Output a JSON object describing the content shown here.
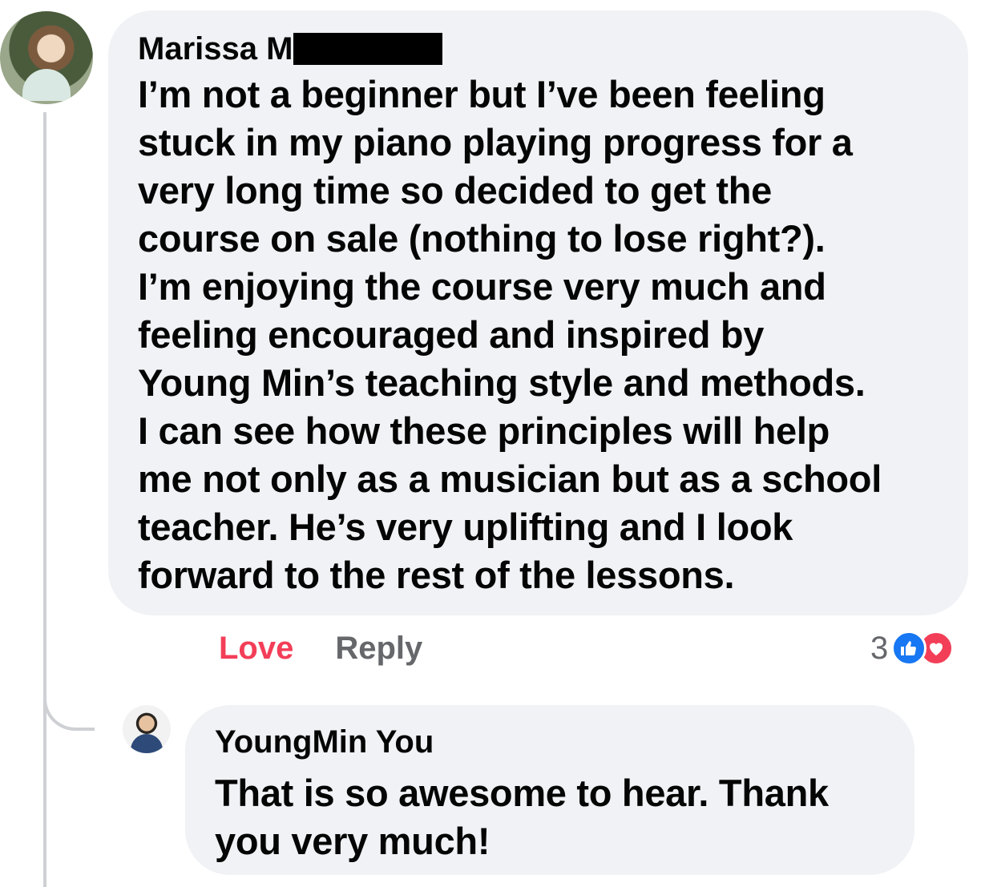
{
  "comment": {
    "author": "Marissa M",
    "author_redacted": true,
    "body_lines": [
      "I’m not a beginner but I’ve been feeling",
      "stuck in my piano playing progress for a",
      "very long time so decided to get the",
      "course on sale (nothing to lose right?).",
      "I’m enjoying the course very much and",
      "feeling encouraged and inspired by",
      "Young Min’s teaching style and methods.",
      "I can see how these principles will help",
      "me not only as a musician but as a school",
      "teacher. He’s very uplifting and I look",
      "forward to the rest of the lessons."
    ],
    "actions": {
      "love_label": "Love",
      "reply_label": "Reply"
    },
    "reactions": {
      "count": "3",
      "types": [
        "like-icon",
        "heart-icon"
      ]
    }
  },
  "reply": {
    "author": "YoungMin You",
    "body_lines": [
      "That is so awesome to hear. Thank",
      "you very much!"
    ]
  },
  "colors": {
    "bubble": "#f0f2f5",
    "love": "#f33e58",
    "secondary_text": "#65676b",
    "like": "#1877f2",
    "thread_line": "#ced0d4"
  }
}
